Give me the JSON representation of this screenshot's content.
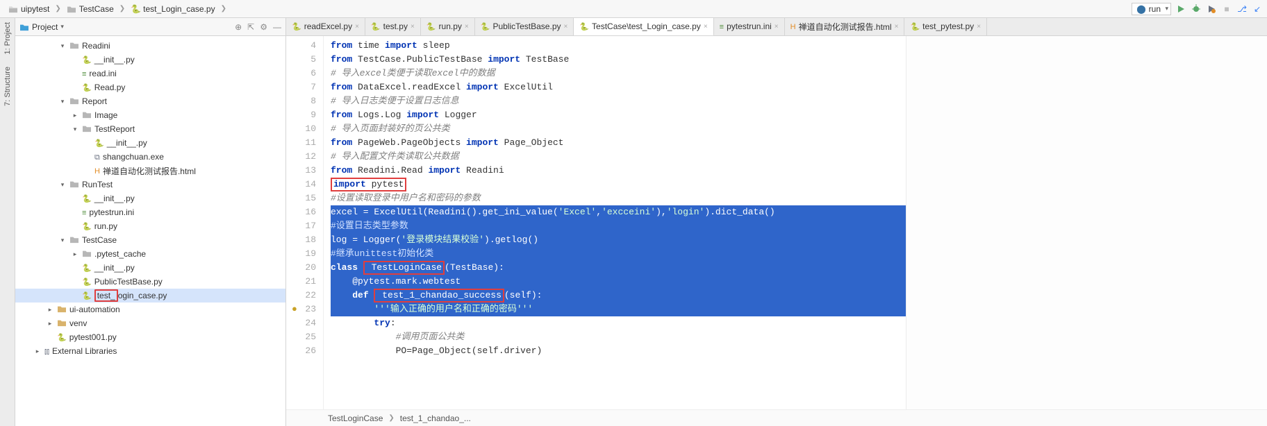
{
  "breadcrumbs": [
    "uipytest",
    "TestCase",
    "test_Login_case.py"
  ],
  "run_config": "run",
  "toolbar_icons": [
    "play",
    "bug",
    "run-cov",
    "stop",
    "branch",
    "sync"
  ],
  "left_rails": [
    {
      "label": "1: Project",
      "icon": "project"
    },
    {
      "label": "7: Structure",
      "icon": "structure"
    }
  ],
  "project_panel": {
    "title": "Project",
    "actions": [
      "target",
      "collapse",
      "gear",
      "hide"
    ],
    "tree": [
      {
        "d": 3,
        "exp": "v",
        "icon": "dir",
        "label": "Readini"
      },
      {
        "d": 4,
        "exp": "",
        "icon": "py",
        "label": "__init__.py"
      },
      {
        "d": 4,
        "exp": "",
        "icon": "ini",
        "label": "read.ini"
      },
      {
        "d": 4,
        "exp": "",
        "icon": "py",
        "label": "Read.py"
      },
      {
        "d": 3,
        "exp": "v",
        "icon": "dir",
        "label": "Report"
      },
      {
        "d": 4,
        "exp": ">",
        "icon": "dir",
        "label": "Image"
      },
      {
        "d": 4,
        "exp": "v",
        "icon": "dir",
        "label": "TestReport"
      },
      {
        "d": 5,
        "exp": "",
        "icon": "py",
        "label": "__init__.py"
      },
      {
        "d": 5,
        "exp": "",
        "icon": "exe",
        "label": "shangchuan.exe"
      },
      {
        "d": 5,
        "exp": "",
        "icon": "html",
        "label": "禅道自动化测试报告.html"
      },
      {
        "d": 3,
        "exp": "v",
        "icon": "dir",
        "label": "RunTest"
      },
      {
        "d": 4,
        "exp": "",
        "icon": "py",
        "label": "__init__.py"
      },
      {
        "d": 4,
        "exp": "",
        "icon": "ini",
        "label": "pytestrun.ini"
      },
      {
        "d": 4,
        "exp": "",
        "icon": "py",
        "label": "run.py"
      },
      {
        "d": 3,
        "exp": "v",
        "icon": "dir",
        "label": "TestCase"
      },
      {
        "d": 4,
        "exp": ">",
        "icon": "dir",
        "label": ".pytest_cache"
      },
      {
        "d": 4,
        "exp": "",
        "icon": "py",
        "label": "__init__.py"
      },
      {
        "d": 4,
        "exp": "",
        "icon": "py",
        "label": "PublicTestBase.py"
      },
      {
        "d": 4,
        "exp": "",
        "icon": "py",
        "label": "test_Login_case.py",
        "sel": true,
        "red_prefix": "test_",
        "label2": "ogin_case.py"
      },
      {
        "d": 2,
        "exp": ">",
        "icon": "dir-ex",
        "label": "ui-automation"
      },
      {
        "d": 2,
        "exp": ">",
        "icon": "dir-ex",
        "label": "venv"
      },
      {
        "d": 2,
        "exp": "",
        "icon": "py",
        "label": "pytest001.py"
      },
      {
        "d": 1,
        "exp": ">",
        "icon": "lib",
        "label": "External Libraries"
      }
    ]
  },
  "tabs": [
    {
      "icon": "py",
      "label": "readExcel.py"
    },
    {
      "icon": "py",
      "label": "test.py"
    },
    {
      "icon": "py",
      "label": "run.py"
    },
    {
      "icon": "py",
      "label": "PublicTestBase.py"
    },
    {
      "icon": "py",
      "label": "TestCase\\test_Login_case.py",
      "active": true
    },
    {
      "icon": "ini",
      "label": "pytestrun.ini"
    },
    {
      "icon": "html",
      "label": "禅道自动化测试报告.html"
    },
    {
      "icon": "py",
      "label": "test_pytest.py"
    }
  ],
  "gutter_start": 4,
  "gutter_end": 26,
  "code_lines": [
    {
      "n": 4,
      "html": "<span class='kw'>from</span> time <span class='kw'>import</span> sleep"
    },
    {
      "n": 5,
      "html": "<span class='kw'>from</span> TestCase.PublicTestBase <span class='kw'>import</span> TestBase"
    },
    {
      "n": 6,
      "html": "<span class='cm'># 导入excel类便于读取excel中的数据</span>"
    },
    {
      "n": 7,
      "html": "<span class='kw'>from</span> DataExcel.readExcel <span class='kw'>import</span> ExcelUtil"
    },
    {
      "n": 8,
      "html": "<span class='cm'># 导入日志类便于设置日志信息</span>"
    },
    {
      "n": 9,
      "html": "<span class='kw'>from</span> Logs.Log <span class='kw'>import</span> Logger"
    },
    {
      "n": 10,
      "html": "<span class='cm'># 导入页面封装好的页公共类</span>"
    },
    {
      "n": 11,
      "html": "<span class='kw'>from</span> PageWeb.PageObjects <span class='kw'>import</span> Page_Object"
    },
    {
      "n": 12,
      "html": "<span class='cm'># 导入配置文件类读取公共数据</span>"
    },
    {
      "n": 13,
      "html": "<span class='kw'>from</span> Readini.Read <span class='kw'>import</span> Readini"
    },
    {
      "n": 14,
      "html": "<span class='red-inline'><span class='kw'>import</span> pytest</span>"
    },
    {
      "n": 15,
      "html": "<span class='cm'>#设置读取登录中用户名和密码的参数</span>"
    },
    {
      "n": 16,
      "sel": true,
      "html": "excel = ExcelUtil(Readini().get_ini_value(<span class='str'>'Excel'</span>,<span class='str'>'excceini'</span>),<span class='str'>'login'</span>).dict_data()"
    },
    {
      "n": 17,
      "sel": true,
      "html": "<span class='cm'>#设置日志类型参数</span>"
    },
    {
      "n": 18,
      "sel": true,
      "html": "log = Logger(<span class='str'>'登录模块结果校验'</span>).getlog()"
    },
    {
      "n": 19,
      "sel": true,
      "html": "<span class='cm'>#继承unittest初始化类</span>"
    },
    {
      "n": 20,
      "sel": true,
      "html": "<span class='kw'>class</span> <span class='red-inline' style='color:#fff;background:#2f65ca;'> TestLoginCase</span>(TestBase):"
    },
    {
      "n": 21,
      "sel": true,
      "html": "    @pytest.mark.webtest"
    },
    {
      "n": 22,
      "sel": true,
      "html": "    <span class='kw'>def</span> <span class='red-inline' style='color:#fff;background:#2f65ca;'> test_1_chandao_success</span>(self):"
    },
    {
      "n": 23,
      "sel": true,
      "dot": true,
      "html": "        <span class='str'>'''输入正确的用户名和正确的密码'''</span>"
    },
    {
      "n": 24,
      "html": "        <span class='kw'>try</span>:"
    },
    {
      "n": 25,
      "html": "            <span class='cm'>#调用页面公共类</span>"
    },
    {
      "n": 26,
      "html": "            PO=Page_Object(self.driver)"
    }
  ],
  "status_breadcrumb": [
    "TestLoginCase",
    "test_1_chandao_..."
  ]
}
